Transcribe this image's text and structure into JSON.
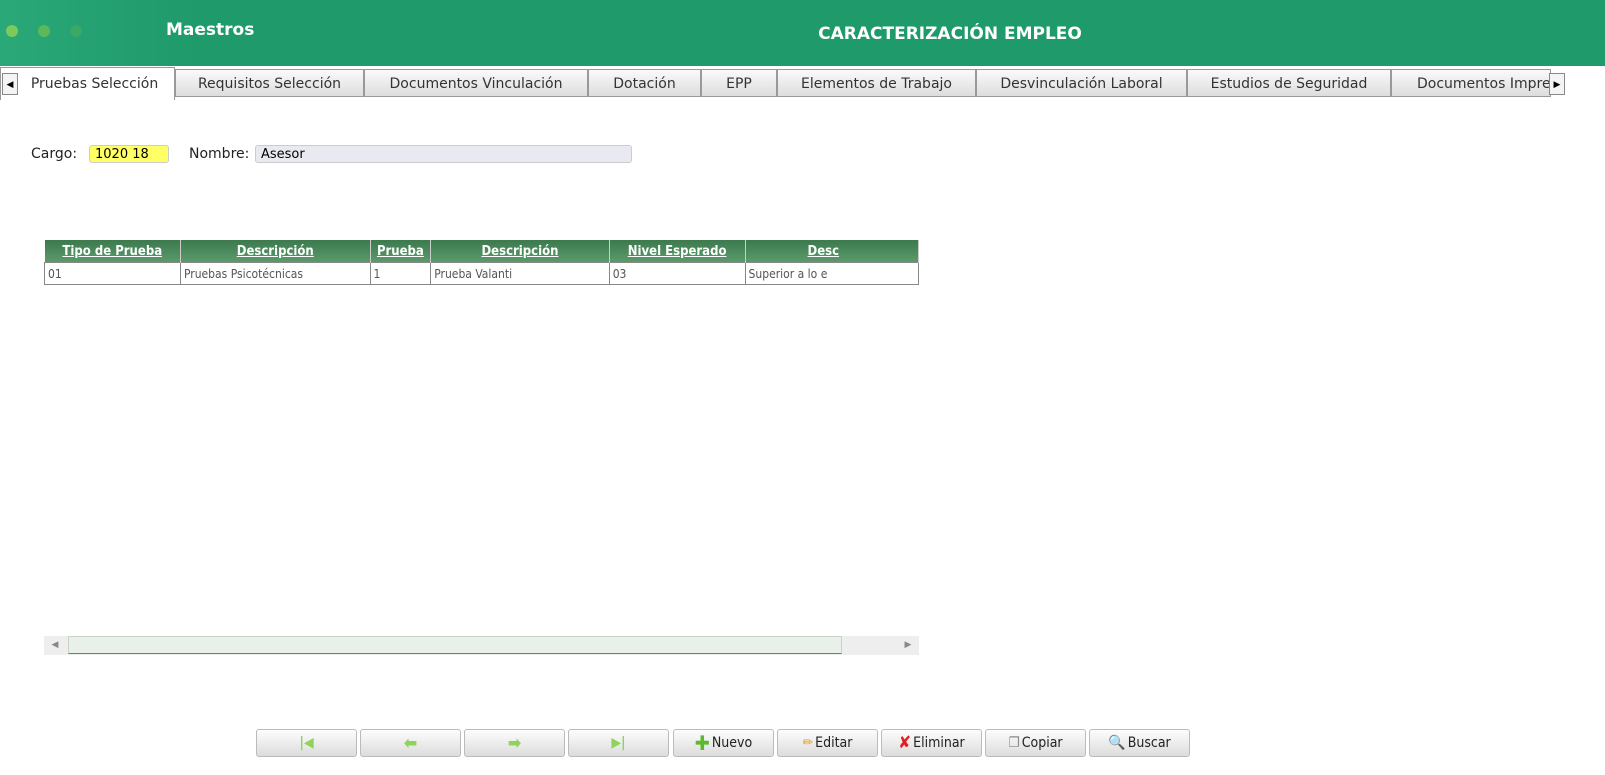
{
  "header": {
    "app": "Maestros",
    "title": "CARACTERIZACIÓN EMPLEO"
  },
  "tabs": [
    "Pruebas Selección",
    "Requisitos Selección",
    "Documentos Vinculación",
    "Dotación",
    "EPP",
    "Elementos de Trabajo",
    "Desvinculación Laboral",
    "Estudios de Seguridad",
    "Documentos Impre"
  ],
  "form": {
    "cargo_label": "Cargo:",
    "cargo_value": "1020 18",
    "nombre_label": "Nombre:",
    "nombre_value": "Asesor"
  },
  "table": {
    "headers": [
      "Tipo de Prueba",
      "Descripción",
      "Prueba",
      "Descripción",
      "Nivel Esperado",
      "Desc"
    ],
    "rows": [
      [
        "01",
        "Pruebas Psicotécnicas",
        "1",
        "Prueba Valanti",
        "03",
        "Superior a lo e"
      ]
    ]
  },
  "buttons": {
    "nuevo": "Nuevo",
    "editar": "Editar",
    "eliminar": "Eliminar",
    "copiar": "Copiar",
    "buscar": "Buscar"
  },
  "colors": {
    "header": "#1f9a6a",
    "cargo_bg": "#ffff66",
    "table_header": "#4a8a5a"
  }
}
